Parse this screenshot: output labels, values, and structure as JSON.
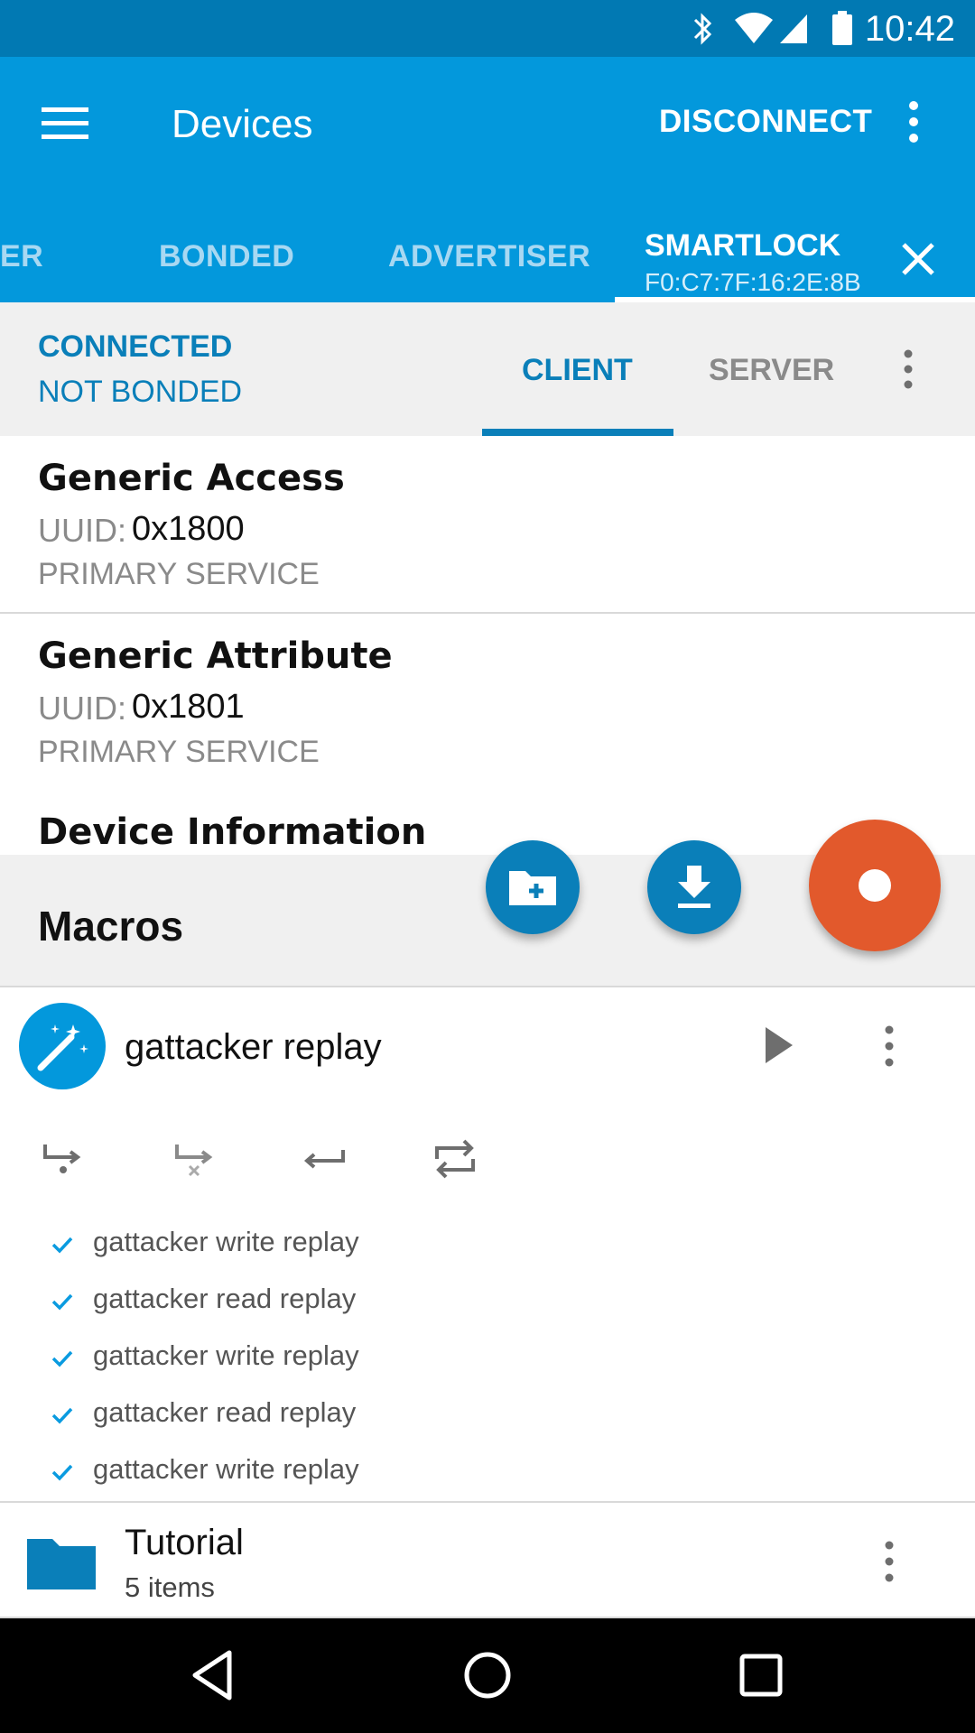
{
  "status_bar": {
    "time": "10:42",
    "icons": [
      "bluetooth-icon",
      "wifi-icon",
      "signal-icon",
      "battery-icon"
    ]
  },
  "app_bar": {
    "title": "Devices",
    "disconnect_label": "DISCONNECT"
  },
  "device_tabs": {
    "items": [
      {
        "label": "ER"
      },
      {
        "label": "BONDED"
      },
      {
        "label": "ADVERTISER"
      }
    ],
    "active": {
      "name": "SMARTLOCK",
      "address": "F0:C7:7F:16:2E:8B"
    }
  },
  "connection": {
    "state": "CONNECTED",
    "bond_state": "NOT BONDED",
    "tabs": [
      "CLIENT",
      "SERVER"
    ],
    "active_tab": "CLIENT"
  },
  "services": [
    {
      "name": "Generic Access",
      "uuid_label": "UUID:",
      "uuid": "0x1800",
      "type": "PRIMARY SERVICE"
    },
    {
      "name": "Generic Attribute",
      "uuid_label": "UUID:",
      "uuid": "0x1801",
      "type": "PRIMARY SERVICE"
    },
    {
      "name": "Device Information"
    }
  ],
  "macros": {
    "title": "Macros",
    "macro": {
      "name": "gattacker replay",
      "steps": [
        "gattacker write replay",
        "gattacker read replay",
        "gattacker write replay",
        "gattacker read replay",
        "gattacker write replay"
      ]
    },
    "folder": {
      "name": "Tutorial",
      "count": "5 items"
    }
  },
  "colors": {
    "status_bar": "#0179b3",
    "app_bar": "#0398dc",
    "accent": "#0a7fb9",
    "record_fab": "#e2592c"
  }
}
